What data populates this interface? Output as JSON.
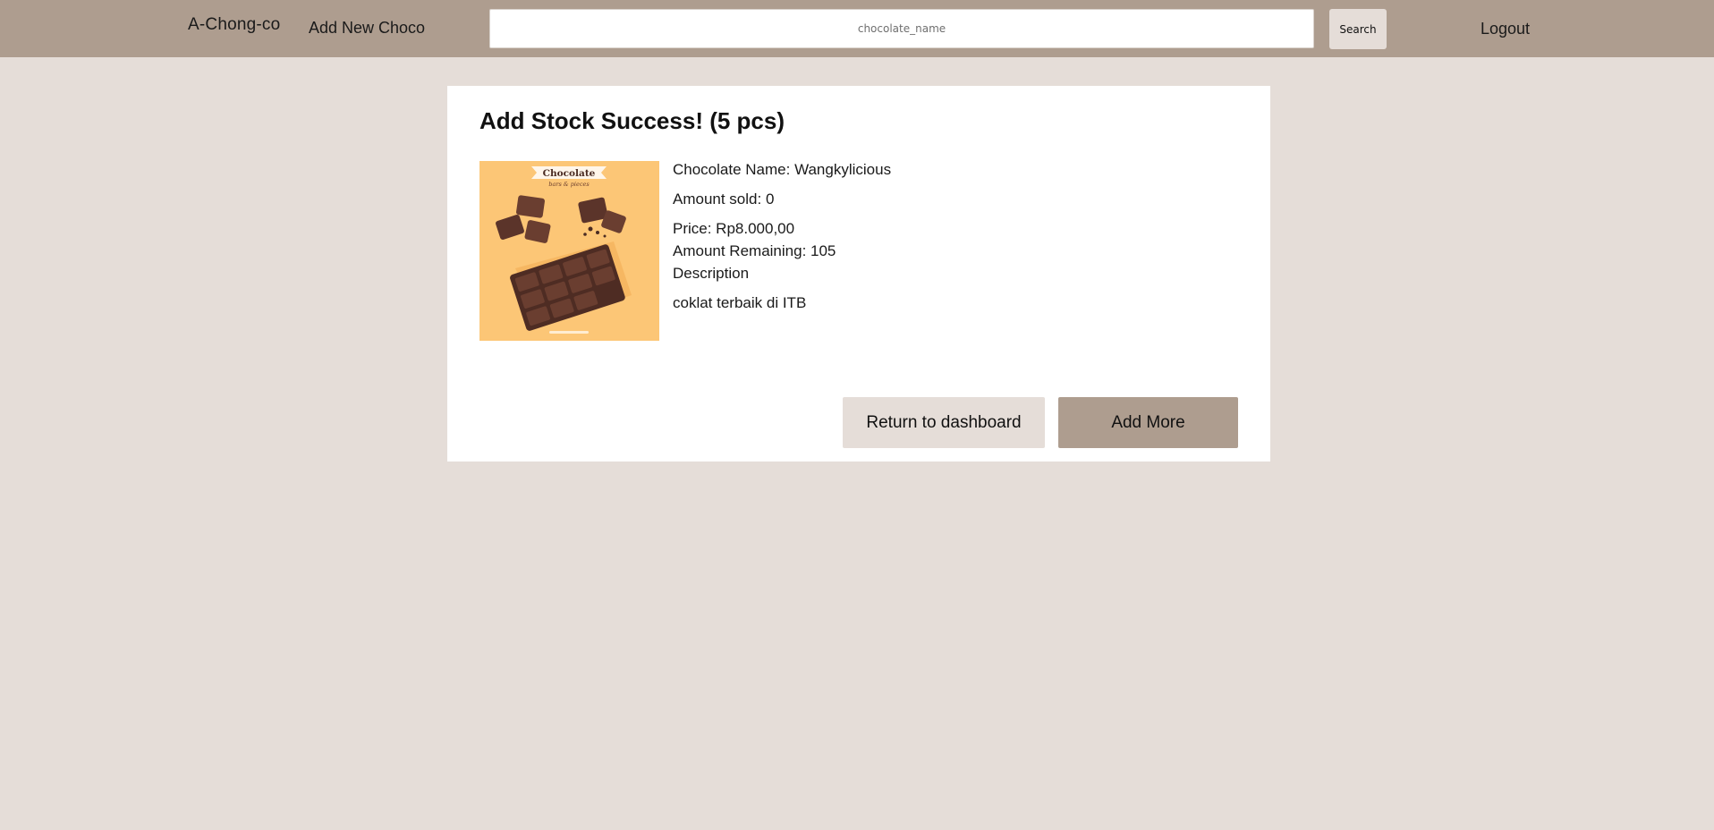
{
  "navbar": {
    "brand": "A-Chong-co",
    "add_new_label": "Add New Choco",
    "search_placeholder": "chocolate_name",
    "search_label": "Search",
    "logout_label": "Logout"
  },
  "card": {
    "title": "Add Stock Success! (5 pcs)",
    "image": {
      "banner_title": "Chocolate",
      "banner_subtitle": "bars & pieces"
    },
    "details": {
      "name_line": "Chocolate Name: Wangkylicious",
      "sold_line": "Amount sold: 0",
      "price_line": "Price: Rp8.000,00",
      "remaining_line": "Amount Remaining: 105",
      "description_label": "Description",
      "description_text": "coklat terbaik di ITB"
    },
    "buttons": {
      "return_label": "Return to dashboard",
      "more_label": "Add More"
    }
  },
  "colors": {
    "navbar": "#ae9d8f",
    "page_background": "#e5ddd8",
    "card_background": "#ffffff",
    "image_background": "#fcc676",
    "chocolate": "#5b342a"
  }
}
